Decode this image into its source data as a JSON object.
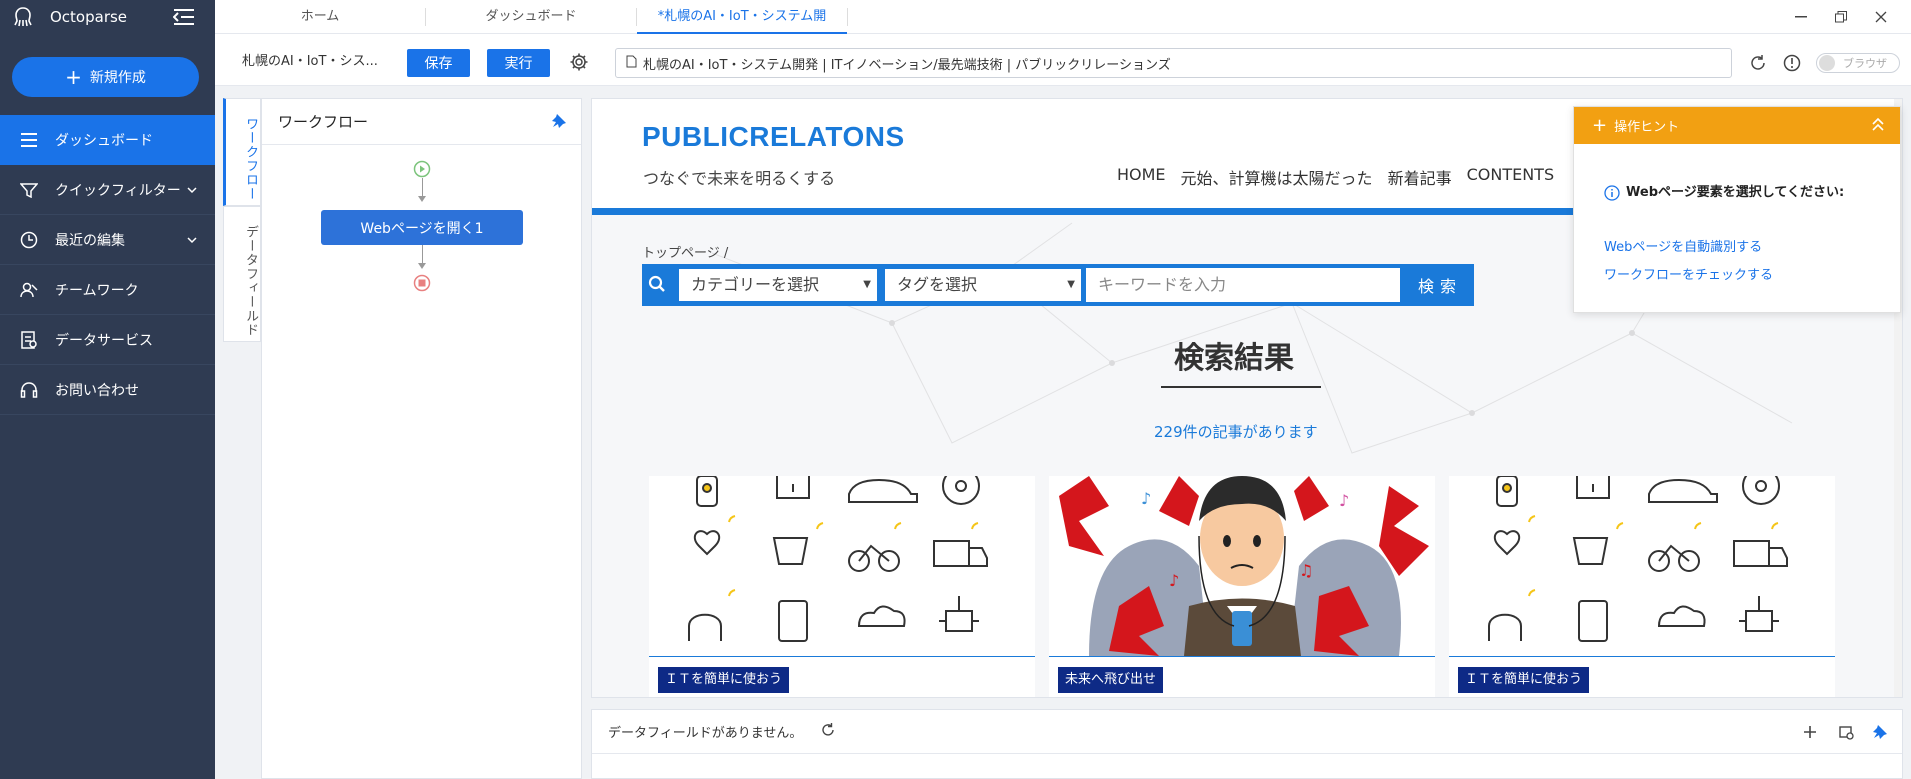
{
  "app": {
    "name": "Octoparse",
    "new_button": "新規作成"
  },
  "sidebar": {
    "items": [
      {
        "label": "ダッシュボード",
        "icon": "list-icon"
      },
      {
        "label": "クイックフィルター",
        "icon": "filter-icon"
      },
      {
        "label": "最近の編集",
        "icon": "clock-icon"
      },
      {
        "label": "チームワーク",
        "icon": "team-icon"
      },
      {
        "label": "データサービス",
        "icon": "data-service-icon"
      },
      {
        "label": "お問い合わせ",
        "icon": "headset-icon"
      }
    ]
  },
  "tabs": [
    {
      "label": "ホーム"
    },
    {
      "label": "ダッシュボード"
    },
    {
      "label": "*札幌のAI・IoT・システム開"
    }
  ],
  "toolbar": {
    "task_name": "札幌のAI・IoT・シス...",
    "save_label": "保存",
    "run_label": "実行",
    "url": "札幌のAI・IoT・システム開発 | ITイノベーション/最先端技術 | パブリックリレーションズ",
    "browser_toggle": "ブラウザ"
  },
  "vtabs": {
    "workflow": "ワークフロー",
    "datafield": "データフィールド"
  },
  "workflow": {
    "title": "ワークフロー",
    "node_label": "Webページを開く1"
  },
  "site": {
    "title": "PUBLICRELATONS",
    "subtitle": "つなぐで未来を明るくする",
    "nav": [
      "HOME",
      "元始、計算機は太陽だった",
      "新着記事",
      "CONTENTS"
    ],
    "breadcrumb": "トップページ /",
    "category_select": "カテゴリーを選択",
    "tag_select": "タグを選択",
    "keyword_placeholder": "キーワードを入力",
    "search_button": "検索",
    "results_title": "検索結果",
    "results_count": "229件の記事があります",
    "cards": [
      {
        "badge": "ＩＴを簡単に使おう"
      },
      {
        "badge": "未来へ飛び出せ"
      },
      {
        "badge": "ＩＴを簡単に使おう"
      }
    ]
  },
  "hint": {
    "title": "操作ヒント",
    "message": "Webページ要素を選択してください:",
    "link_auto": "Webページを自動識別する",
    "link_check": "ワークフローをチェックする"
  },
  "datafield": {
    "empty_text": "データフィールドがありません。"
  },
  "colors": {
    "sidebar_bg": "#2f3b52",
    "accent": "#1a73e8",
    "hint_orange": "#f2a012",
    "badge_navy": "#0e2a86"
  }
}
